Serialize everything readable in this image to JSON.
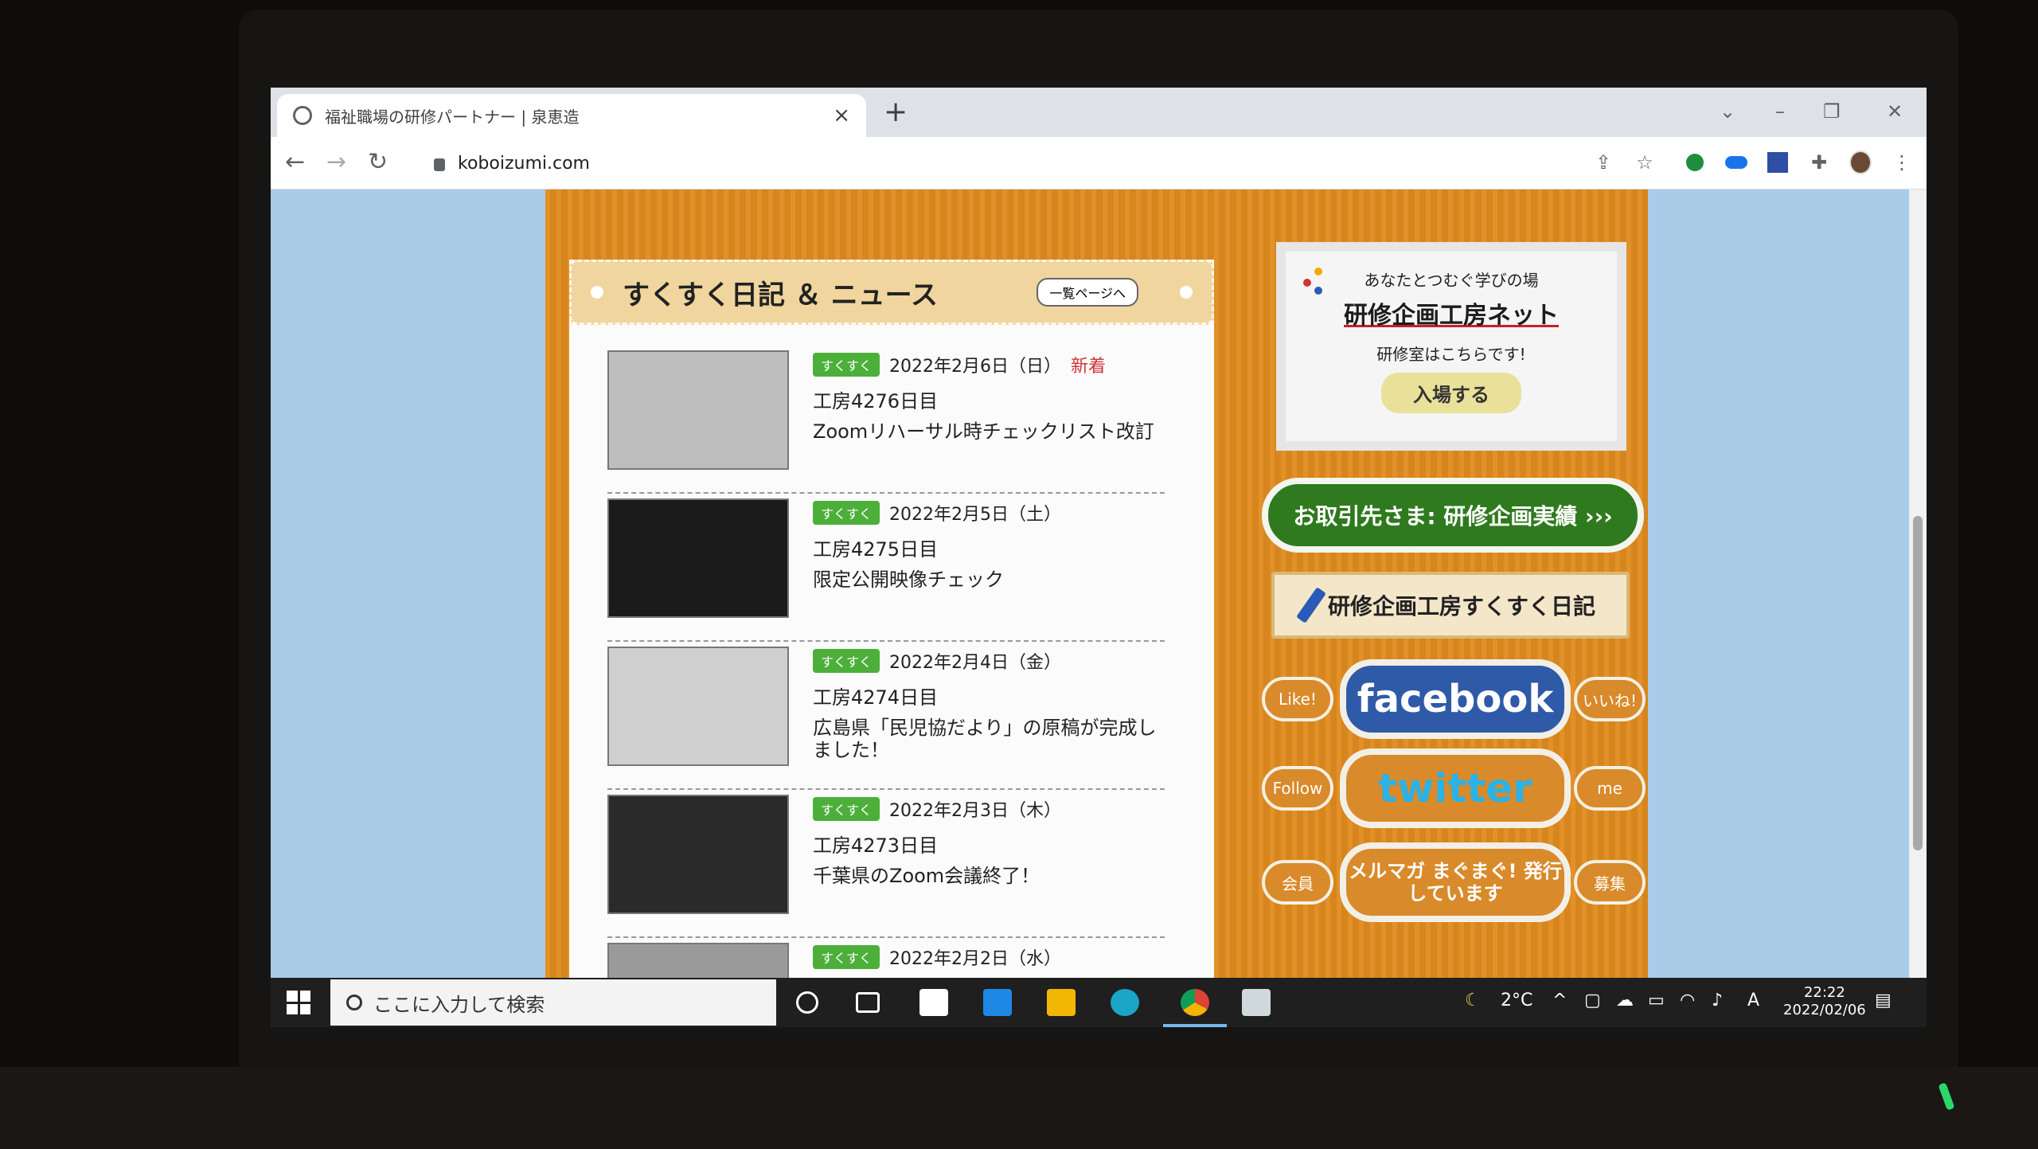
{
  "browser": {
    "tab_title": "福祉職場の研修パートナー | 泉恵造",
    "tab_close": "×",
    "new_tab": "+",
    "url": "koboizumi.com"
  },
  "news": {
    "header_title": "すくすく日記 ＆ ニュース",
    "list_button": "一覧ページへ",
    "items": [
      {
        "tag": "すくすく",
        "date": "2022年2月6日（日）",
        "flag": "新着",
        "day": "工房4276日目",
        "headline": "Zoomリハーサル時チェックリスト改訂"
      },
      {
        "tag": "すくすく",
        "date": "2022年2月5日（土）",
        "flag": "",
        "day": "工房4275日目",
        "headline": "限定公開映像チェック"
      },
      {
        "tag": "すくすく",
        "date": "2022年2月4日（金）",
        "flag": "",
        "day": "工房4274日目",
        "headline": "広島県「民児協だより」の原稿が完成しました！"
      },
      {
        "tag": "すくすく",
        "date": "2022年2月3日（木）",
        "flag": "",
        "day": "工房4273日目",
        "headline": "千葉県のZoom会議終了！"
      },
      {
        "tag": "すくすく",
        "date": "2022年2月2日（水）",
        "flag": "",
        "day": "",
        "headline": ""
      }
    ]
  },
  "sidebar": {
    "kobo_line1": "あなたとつむぐ学びの場",
    "kobo_line2": "研修企画工房ネット",
    "kobo_line3": "研修室はこちらです!",
    "kobo_enter": "入場する",
    "partners_button": "お取引先さま: 研修企画実績 ›››",
    "diary_button": "研修企画工房すくすく日記",
    "facebook": {
      "left": "Like!",
      "main": "facebook",
      "right": "いいね!"
    },
    "twitter": {
      "left": "Follow",
      "main": "twitter",
      "right": "me"
    },
    "mailmag": {
      "left": "会員",
      "main": "メルマガ まぐまぐ! 発行しています",
      "right": "募集"
    }
  },
  "taskbar": {
    "search_placeholder": "ここに入力して検索",
    "weather": "2°C",
    "ime": "A",
    "time": "22:22",
    "date": "2022/02/06"
  },
  "colors": {
    "tag_green": "#4caf3a",
    "new_red": "#d0343a",
    "wood_orange": "#e08a1e",
    "facebook_blue": "#2f5aa8",
    "twitter_cyan": "#2bb2e6"
  }
}
